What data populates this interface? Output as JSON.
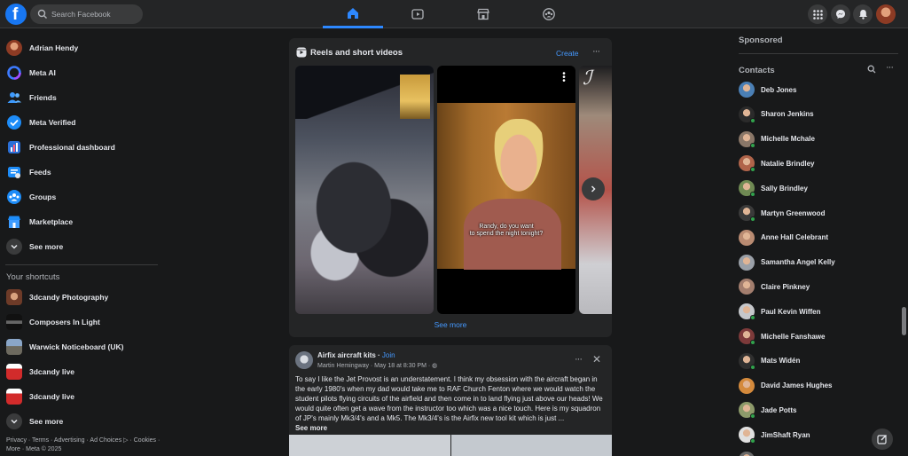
{
  "topbar": {
    "search_placeholder": "Search Facebook",
    "nav_icons": [
      "home-icon",
      "video-icon",
      "marketplace-icon",
      "groups-icon"
    ],
    "right_icons": [
      "menu-grid-icon",
      "messenger-icon",
      "bell-icon",
      "profile-avatar"
    ],
    "accent": "#2d88ff"
  },
  "sidebar": {
    "items": [
      {
        "label": "Adrian Hendy",
        "icon": "profile-avatar"
      },
      {
        "label": "Meta AI",
        "icon": "meta-ai-icon"
      },
      {
        "label": "Friends",
        "icon": "friends-icon"
      },
      {
        "label": "Meta Verified",
        "icon": "verified-icon"
      },
      {
        "label": "Professional dashboard",
        "icon": "dashboard-icon"
      },
      {
        "label": "Feeds",
        "icon": "feeds-icon"
      },
      {
        "label": "Groups",
        "icon": "groups-icon"
      },
      {
        "label": "Marketplace",
        "icon": "marketplace-icon"
      },
      {
        "label": "See more",
        "icon": "chevron-down-icon"
      }
    ],
    "shortcuts_title": "Your shortcuts",
    "shortcuts": [
      {
        "label": "3dcandy Photography"
      },
      {
        "label": "Composers In Light"
      },
      {
        "label": "Warwick Noticeboard (UK)"
      },
      {
        "label": "3dcandy live"
      },
      {
        "label": "3dcandy live"
      },
      {
        "label": "See more"
      }
    ],
    "footer_line1": "Privacy · Terms · Advertising · Ad Choices ▷ · Cookies ·",
    "footer_line2": "More · Meta © 2025"
  },
  "reels": {
    "title": "Reels and short videos",
    "create_label": "Create",
    "more_label": "···",
    "caption_line1": "Randy, do you want",
    "caption_line2": "to spend the night tonight?",
    "see_more": "See more"
  },
  "post": {
    "group": "Airfix aircraft kits",
    "separator": " · ",
    "join": "Join",
    "meta": "Martin Hemingway · May 18 at 8:30 PM · ◍",
    "more_label": "···",
    "close_label": "✕",
    "text": "To say I like the Jet Provost is an understatement.  I think my obsession with the aircraft began in the early 1980's when my dad would take me to RAF Church Fenton where we would watch the student pilots flying circuits of the airfield and then come in to land flying just above our heads! We would quite often get a wave from the instructor too which was a nice touch. Here is my squadron of JP's mainly Mk3/4's and a Mk5.  The Mk3/4's is the Airfix new tool kit which is just ...",
    "see_more": "See more"
  },
  "right": {
    "sponsored": "Sponsored",
    "contacts_title": "Contacts",
    "contacts": [
      {
        "name": "Deb Jones",
        "online": false,
        "color": "#4a7fb5"
      },
      {
        "name": "Sharon Jenkins",
        "online": true,
        "color": "#2b2b2b"
      },
      {
        "name": "Michelle Mchale",
        "online": true,
        "color": "#8a7768"
      },
      {
        "name": "Natalie Brindley",
        "online": true,
        "color": "#b0644a"
      },
      {
        "name": "Sally Brindley",
        "online": true,
        "color": "#6f8a53"
      },
      {
        "name": "Martyn Greenwood",
        "online": true,
        "color": "#3a3a3a"
      },
      {
        "name": "Anne Hall Celebrant",
        "online": false,
        "color": "#b98b72"
      },
      {
        "name": "Samantha Angel Kelly",
        "online": false,
        "color": "#9aa0a8"
      },
      {
        "name": "Claire Pinkney",
        "online": false,
        "color": "#a37e6e"
      },
      {
        "name": "Paul Kevin Wiffen",
        "online": true,
        "color": "#c5c7cb"
      },
      {
        "name": "Michelle Fanshawe",
        "online": true,
        "color": "#7d3a3a"
      },
      {
        "name": "Mats Widén",
        "online": true,
        "color": "#2f2f2f"
      },
      {
        "name": "David James Hughes",
        "online": false,
        "color": "#d48a3c"
      },
      {
        "name": "Jade Potts",
        "online": true,
        "color": "#8d9a6a"
      },
      {
        "name": "JimShaft Ryan",
        "online": true,
        "color": "#e0e0e0"
      },
      {
        "name": "",
        "online": false,
        "color": "#6a6a6a"
      }
    ]
  }
}
